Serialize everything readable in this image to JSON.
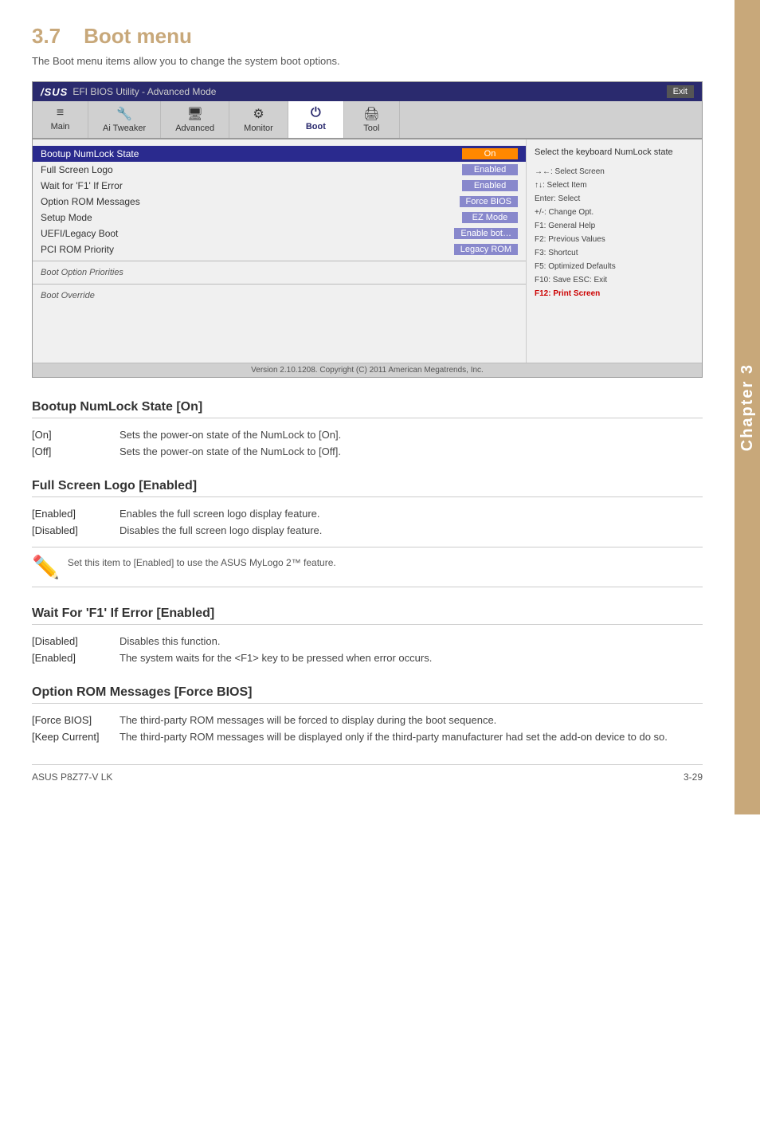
{
  "page": {
    "chapter": "Chapter 3",
    "section_number": "3.7",
    "section_title": "Boot menu",
    "subtitle": "The Boot menu items allow you to change the system boot options.",
    "footer_left": "ASUS P8Z77-V LK",
    "footer_right": "3-29"
  },
  "bios": {
    "titlebar": {
      "logo": "/SUS",
      "mode": "EFI BIOS Utility - Advanced Mode",
      "exit_label": "Exit"
    },
    "nav_items": [
      {
        "label": "Main",
        "icon": "≡",
        "active": false
      },
      {
        "label": "Ai Tweaker",
        "icon": "🔧",
        "active": false
      },
      {
        "label": "Advanced",
        "icon": "🖥",
        "active": false
      },
      {
        "label": "Monitor",
        "icon": "⚙",
        "active": false
      },
      {
        "label": "Boot",
        "icon": "⏻",
        "active": true
      },
      {
        "label": "Tool",
        "icon": "🖨",
        "active": false
      }
    ],
    "rows": [
      {
        "label": "Bootup NumLock State",
        "value": "On",
        "highlight": true
      },
      {
        "label": "Full Screen Logo",
        "value": "Enabled",
        "highlight": false
      },
      {
        "label": "Wait for 'F1' If Error",
        "value": "Enabled",
        "highlight": false
      },
      {
        "label": "Option ROM Messages",
        "value": "Force BIOS",
        "highlight": false
      },
      {
        "label": "Setup Mode",
        "value": "EZ Mode",
        "highlight": false
      },
      {
        "label": "UEFI/Legacy Boot",
        "value": "Enable bot…",
        "highlight": false
      },
      {
        "label": "PCI ROM Priority",
        "value": "Legacy ROM",
        "highlight": false
      }
    ],
    "section_labels": [
      "Boot Option Priorities",
      "Boot Override"
    ],
    "help_text": "Select the keyboard NumLock state",
    "keys": [
      "→←: Select Screen",
      "↑↓: Select Item",
      "Enter: Select",
      "+/-: Change Opt.",
      "F1:  General Help",
      "F2:  Previous Values",
      "F3:  Shortcut",
      "F5:  Optimized Defaults",
      "F10: Save  ESC: Exit",
      "F12: Print Screen"
    ],
    "highlight_key": "F12: Print Screen",
    "footer": "Version  2.10.1208.   Copyright  (C)  2011  American  Megatrends,  Inc."
  },
  "sections": [
    {
      "id": "bootup-numlock",
      "heading": "Bootup NumLock State [On]",
      "rows": [
        {
          "option": "[On]",
          "description": "Sets the power-on state of the NumLock to [On]."
        },
        {
          "option": "[Off]",
          "description": "Sets the power-on state of the NumLock to [Off]."
        }
      ],
      "has_note": false
    },
    {
      "id": "full-screen-logo",
      "heading": "Full Screen Logo [Enabled]",
      "rows": [
        {
          "option": "[Enabled]",
          "description": "Enables the full screen logo display feature."
        },
        {
          "option": "[Disabled]",
          "description": "Disables the full screen logo display feature."
        }
      ],
      "has_note": true,
      "note_text": "Set this item to [Enabled] to use the ASUS MyLogo 2™ feature."
    },
    {
      "id": "wait-for-f1",
      "heading": "Wait For 'F1' If Error [Enabled]",
      "rows": [
        {
          "option": "[Disabled]",
          "description": "Disables this function."
        },
        {
          "option": "[Enabled]",
          "description": "The system waits for the <F1> key to be pressed when error occurs."
        }
      ],
      "has_note": false
    },
    {
      "id": "option-rom",
      "heading": "Option ROM Messages [Force BIOS]",
      "rows": [
        {
          "option": "[Force BIOS]",
          "description": "The third-party ROM messages will be forced to display during the boot sequence."
        },
        {
          "option": "[Keep Current]",
          "description": "The third-party ROM messages will be displayed only if the third-party manufacturer had set the add-on device to do so."
        }
      ],
      "has_note": false
    }
  ]
}
